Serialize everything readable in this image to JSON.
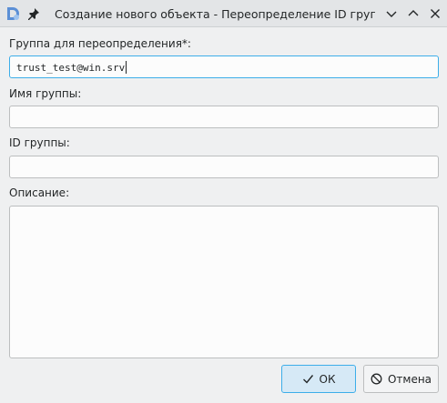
{
  "window": {
    "title": "Создание нового объекта - Переопределение ID группы",
    "icons": [
      "app-logo-icon",
      "pin-icon",
      "chevron-down-icon",
      "chevron-up-icon",
      "close-icon"
    ]
  },
  "form": {
    "override_group_label": "Группа для переопределения*:",
    "override_group_value": "trust_test@win.srv",
    "group_name_label": "Имя группы:",
    "group_name_value": "",
    "group_id_label": "ID группы:",
    "group_id_value": "",
    "description_label": "Описание:",
    "description_value": ""
  },
  "buttons": {
    "ok_label": "ОК",
    "cancel_label": "Отмена"
  },
  "colors": {
    "accent": "#3daee9",
    "window_bg": "#eff0f1"
  }
}
